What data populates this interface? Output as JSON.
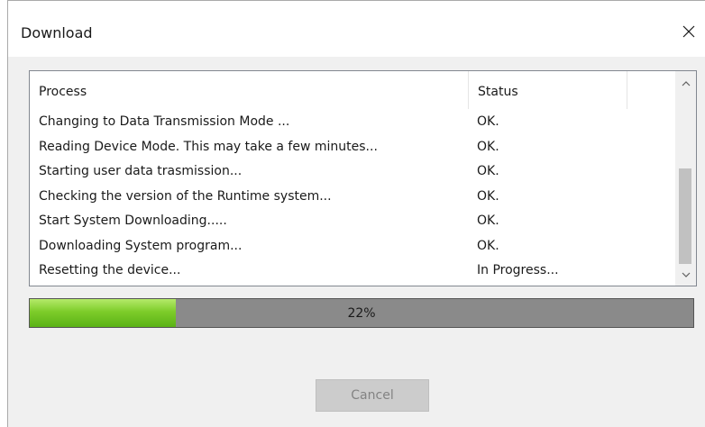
{
  "window": {
    "title": "Download",
    "close_icon": "close-icon"
  },
  "list": {
    "columns": [
      "Process",
      "Status"
    ],
    "rows": [
      {
        "process": "Changing to Data Transmission Mode ...",
        "status": "OK."
      },
      {
        "process": "Reading Device Mode. This may take a few minutes...",
        "status": "OK."
      },
      {
        "process": "Starting user data trasmission...",
        "status": "OK."
      },
      {
        "process": "Checking the version of the Runtime system...",
        "status": "OK."
      },
      {
        "process": "Start System Downloading.....",
        "status": "OK."
      },
      {
        "process": "Downloading System program...",
        "status": "OK."
      },
      {
        "process": "Resetting the device...",
        "status": "In Progress..."
      }
    ]
  },
  "progress": {
    "percent": 22,
    "label": "22%",
    "fill_color": "#7dcc2a",
    "track_color": "#8a8a8a"
  },
  "buttons": {
    "cancel_label": "Cancel",
    "cancel_enabled": false
  }
}
